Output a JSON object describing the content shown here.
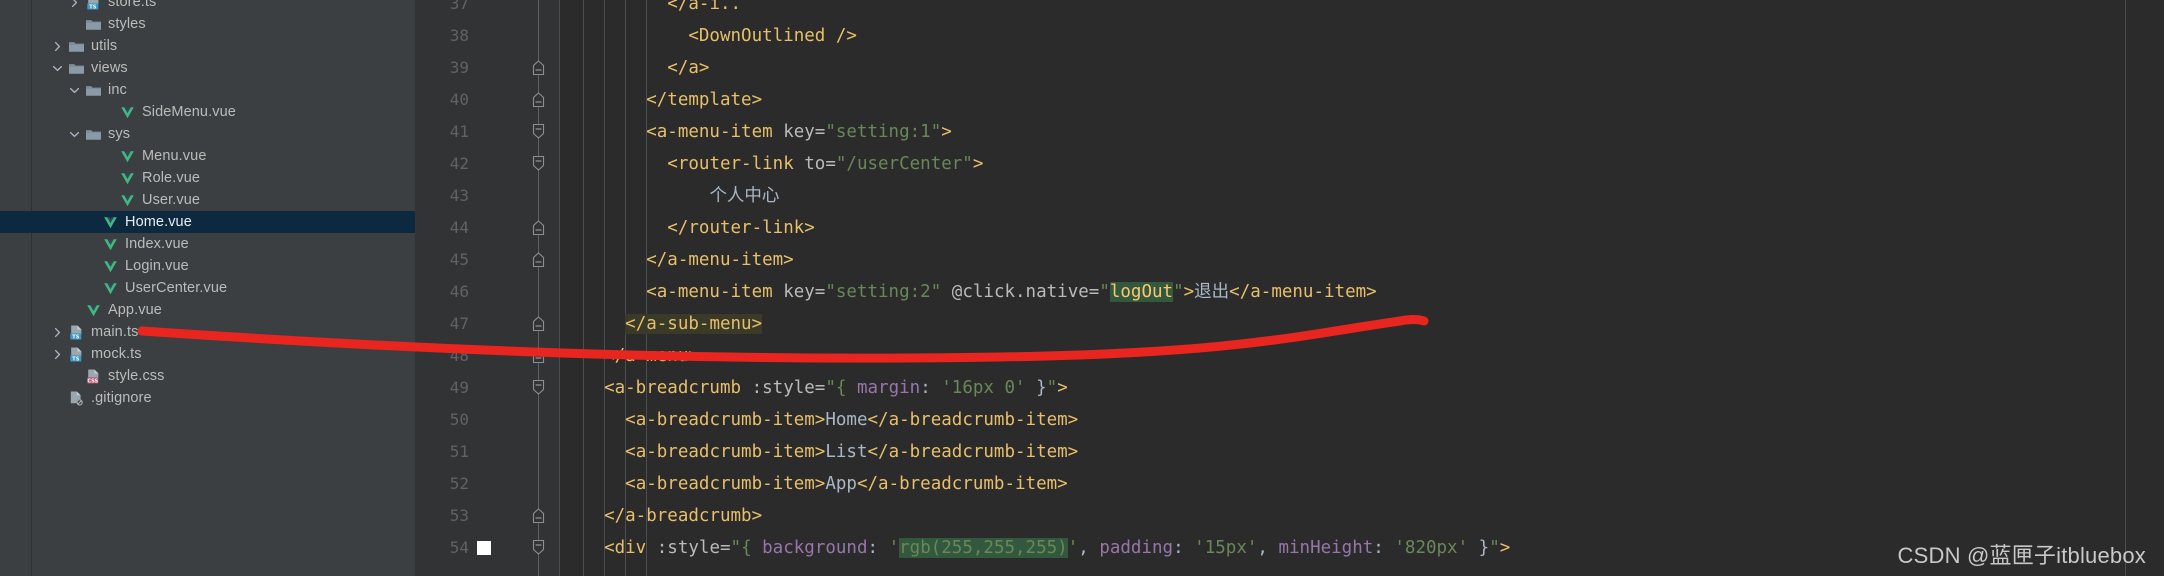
{
  "file_tree": {
    "name": "project-tool-window",
    "items": [
      {
        "label": "store.ts",
        "indent": 4,
        "arrow": "chevron-right",
        "icon": "ts-file-icon",
        "selected": false,
        "clipped_top": true
      },
      {
        "label": "styles",
        "indent": 4,
        "arrow": "none",
        "icon": "folder-icon",
        "selected": false
      },
      {
        "label": "utils",
        "indent": 3,
        "arrow": "chevron-right",
        "icon": "folder-icon",
        "selected": false
      },
      {
        "label": "views",
        "indent": 3,
        "arrow": "chevron-down",
        "icon": "folder-icon",
        "selected": false
      },
      {
        "label": "inc",
        "indent": 4,
        "arrow": "chevron-down",
        "icon": "folder-icon",
        "selected": false
      },
      {
        "label": "SideMenu.vue",
        "indent": 6,
        "arrow": "none",
        "icon": "vue-file-icon",
        "selected": false
      },
      {
        "label": "sys",
        "indent": 4,
        "arrow": "chevron-down",
        "icon": "folder-icon",
        "selected": false
      },
      {
        "label": "Menu.vue",
        "indent": 6,
        "arrow": "none",
        "icon": "vue-file-icon",
        "selected": false
      },
      {
        "label": "Role.vue",
        "indent": 6,
        "arrow": "none",
        "icon": "vue-file-icon",
        "selected": false
      },
      {
        "label": "User.vue",
        "indent": 6,
        "arrow": "none",
        "icon": "vue-file-icon",
        "selected": false
      },
      {
        "label": "Home.vue",
        "indent": 5,
        "arrow": "none",
        "icon": "vue-file-icon",
        "selected": true
      },
      {
        "label": "Index.vue",
        "indent": 5,
        "arrow": "none",
        "icon": "vue-file-icon",
        "selected": false
      },
      {
        "label": "Login.vue",
        "indent": 5,
        "arrow": "none",
        "icon": "vue-file-icon",
        "selected": false
      },
      {
        "label": "UserCenter.vue",
        "indent": 5,
        "arrow": "none",
        "icon": "vue-file-icon",
        "selected": false
      },
      {
        "label": "App.vue",
        "indent": 4,
        "arrow": "none",
        "icon": "vue-file-icon",
        "selected": false
      },
      {
        "label": "main.ts",
        "indent": 3,
        "arrow": "chevron-right",
        "icon": "ts-file-icon",
        "selected": false
      },
      {
        "label": "mock.ts",
        "indent": 3,
        "arrow": "chevron-right",
        "icon": "ts-file-icon",
        "selected": false
      },
      {
        "label": "style.css",
        "indent": 4,
        "arrow": "none",
        "icon": "css-file-icon",
        "selected": false
      },
      {
        "label": ".gitignore",
        "indent": 3,
        "arrow": "none",
        "icon": "ignored-file-icon",
        "selected": false
      }
    ]
  },
  "editor": {
    "name": "code-editor",
    "first_visible_line": 37,
    "lines": [
      {
        "num": 37,
        "fold": "none",
        "breakpoint": false,
        "tokens": [
          {
            "t": "        ",
            "c": "t-text"
          },
          {
            "t": "</a-i..",
            "c": "t-tag"
          }
        ],
        "clipped": true
      },
      {
        "num": 38,
        "fold": "none",
        "breakpoint": false,
        "tokens": [
          {
            "t": "          ",
            "c": "t-text"
          },
          {
            "t": "<DownOutlined />",
            "c": "t-tag"
          }
        ]
      },
      {
        "num": 39,
        "fold": "end",
        "breakpoint": false,
        "tokens": [
          {
            "t": "        ",
            "c": "t-text"
          },
          {
            "t": "</a>",
            "c": "t-tag"
          }
        ]
      },
      {
        "num": 40,
        "fold": "end",
        "breakpoint": false,
        "tokens": [
          {
            "t": "      ",
            "c": "t-text"
          },
          {
            "t": "</template>",
            "c": "t-tag"
          }
        ]
      },
      {
        "num": 41,
        "fold": "start",
        "breakpoint": false,
        "tokens": [
          {
            "t": "      ",
            "c": "t-text"
          },
          {
            "t": "<a-menu-item ",
            "c": "t-tag"
          },
          {
            "t": "key=",
            "c": "t-attrn"
          },
          {
            "t": "\"setting:1\"",
            "c": "t-str"
          },
          {
            "t": ">",
            "c": "t-tag"
          }
        ]
      },
      {
        "num": 42,
        "fold": "start",
        "breakpoint": false,
        "tokens": [
          {
            "t": "        ",
            "c": "t-text"
          },
          {
            "t": "<router-link ",
            "c": "t-tag"
          },
          {
            "t": "to=",
            "c": "t-attrn"
          },
          {
            "t": "\"/userCenter\"",
            "c": "t-str"
          },
          {
            "t": ">",
            "c": "t-tag"
          }
        ]
      },
      {
        "num": 43,
        "fold": "none",
        "breakpoint": false,
        "tokens": [
          {
            "t": "            ",
            "c": "t-text"
          },
          {
            "t": "个人中心",
            "c": "t-text"
          }
        ]
      },
      {
        "num": 44,
        "fold": "end",
        "breakpoint": false,
        "tokens": [
          {
            "t": "        ",
            "c": "t-text"
          },
          {
            "t": "</router-link>",
            "c": "t-tag"
          }
        ]
      },
      {
        "num": 45,
        "fold": "end",
        "breakpoint": false,
        "tokens": [
          {
            "t": "      ",
            "c": "t-text"
          },
          {
            "t": "</a-menu-item>",
            "c": "t-tag"
          }
        ]
      },
      {
        "num": 46,
        "fold": "none",
        "breakpoint": false,
        "tokens": [
          {
            "t": "      ",
            "c": "t-text"
          },
          {
            "t": "<a-menu-item ",
            "c": "t-tag"
          },
          {
            "t": "key=",
            "c": "t-attrn"
          },
          {
            "t": "\"setting:2\"",
            "c": "t-str"
          },
          {
            "t": " ",
            "c": "t-text"
          },
          {
            "t": "@click.native=",
            "c": "t-attrn"
          },
          {
            "t": "\"",
            "c": "t-str"
          },
          {
            "t": "logOut",
            "c": "t-fn hl-ident"
          },
          {
            "t": "\"",
            "c": "t-str"
          },
          {
            "t": ">",
            "c": "t-tag"
          },
          {
            "t": "退出",
            "c": "t-text"
          },
          {
            "t": "</a-menu-item>",
            "c": "t-tag"
          }
        ]
      },
      {
        "num": 47,
        "fold": "end",
        "breakpoint": false,
        "tokens": [
          {
            "t": "    ",
            "c": "t-text"
          },
          {
            "t": "</a-sub-menu>",
            "c": "t-tag hl-match"
          }
        ]
      },
      {
        "num": 48,
        "fold": "end",
        "breakpoint": false,
        "tokens": [
          {
            "t": "  ",
            "c": "t-text"
          },
          {
            "t": "</a-menu>",
            "c": "t-tag"
          }
        ]
      },
      {
        "num": 49,
        "fold": "start",
        "breakpoint": false,
        "tokens": [
          {
            "t": "  ",
            "c": "t-text"
          },
          {
            "t": "<a-breadcrumb ",
            "c": "t-tag"
          },
          {
            "t": ":style=",
            "c": "t-attrn"
          },
          {
            "t": "\"{ ",
            "c": "t-str"
          },
          {
            "t": "margin",
            "c": "t-key"
          },
          {
            "t": ": ",
            "c": "t-punct"
          },
          {
            "t": "'16px 0'",
            "c": "t-num"
          },
          {
            "t": " }",
            "c": "t-punct"
          },
          {
            "t": "\"",
            "c": "t-str"
          },
          {
            "t": ">",
            "c": "t-tag"
          }
        ]
      },
      {
        "num": 50,
        "fold": "none",
        "breakpoint": false,
        "tokens": [
          {
            "t": "    ",
            "c": "t-text"
          },
          {
            "t": "<a-breadcrumb-item>",
            "c": "t-tag"
          },
          {
            "t": "Home",
            "c": "t-text"
          },
          {
            "t": "</a-breadcrumb-item>",
            "c": "t-tag"
          }
        ]
      },
      {
        "num": 51,
        "fold": "none",
        "breakpoint": false,
        "tokens": [
          {
            "t": "    ",
            "c": "t-text"
          },
          {
            "t": "<a-breadcrumb-item>",
            "c": "t-tag"
          },
          {
            "t": "List",
            "c": "t-text"
          },
          {
            "t": "</a-breadcrumb-item>",
            "c": "t-tag"
          }
        ]
      },
      {
        "num": 52,
        "fold": "none",
        "breakpoint": false,
        "tokens": [
          {
            "t": "    ",
            "c": "t-text"
          },
          {
            "t": "<a-breadcrumb-item>",
            "c": "t-tag"
          },
          {
            "t": "App",
            "c": "t-text"
          },
          {
            "t": "</a-breadcrumb-item>",
            "c": "t-tag"
          }
        ]
      },
      {
        "num": 53,
        "fold": "end",
        "breakpoint": false,
        "tokens": [
          {
            "t": "  ",
            "c": "t-text"
          },
          {
            "t": "</a-breadcrumb>",
            "c": "t-tag"
          }
        ]
      },
      {
        "num": 54,
        "fold": "start",
        "breakpoint": true,
        "tokens": [
          {
            "t": "  ",
            "c": "t-text"
          },
          {
            "t": "<div ",
            "c": "t-tag"
          },
          {
            "t": ":style=",
            "c": "t-attrn"
          },
          {
            "t": "\"{ ",
            "c": "t-str"
          },
          {
            "t": "background",
            "c": "t-key"
          },
          {
            "t": ": ",
            "c": "t-punct"
          },
          {
            "t": "'",
            "c": "t-num"
          },
          {
            "t": "rgb(255,255,255)",
            "c": "t-num hl-rgb"
          },
          {
            "t": "'",
            "c": "t-num"
          },
          {
            "t": ", ",
            "c": "t-punct"
          },
          {
            "t": "padding",
            "c": "t-key"
          },
          {
            "t": ": ",
            "c": "t-punct"
          },
          {
            "t": "'15px'",
            "c": "t-num"
          },
          {
            "t": ", ",
            "c": "t-punct"
          },
          {
            "t": "minHeight",
            "c": "t-key"
          },
          {
            "t": ": ",
            "c": "t-punct"
          },
          {
            "t": "'820px'",
            "c": "t-num"
          },
          {
            "t": " }",
            "c": "t-brace"
          },
          {
            "t": "\"",
            "c": "t-str"
          },
          {
            "t": ">",
            "c": "t-tag"
          }
        ]
      }
    ]
  },
  "annotation": {
    "name": "red-underline-annotation",
    "color": "#e8251f",
    "description": "hand-drawn red line from Home.vue in tree across to logOut in code"
  },
  "watermark": {
    "text": "CSDN @蓝匣子itbluebox"
  },
  "colors": {
    "tree_bg": "#3c3f41",
    "editor_bg": "#2b2b2b",
    "gutter_bg": "#313335",
    "selection_bg": "#0d293f",
    "tag": "#e8bf6a",
    "string": "#6a8759",
    "keyword": "#9876aa",
    "function": "#ffc66d",
    "line_number": "#606366",
    "annotation_red": "#e8251f"
  }
}
